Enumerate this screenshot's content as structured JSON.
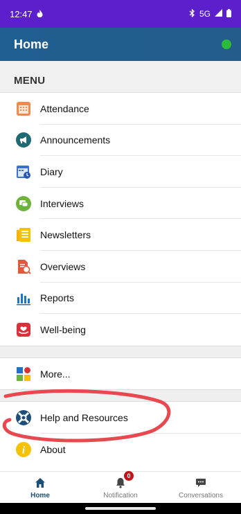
{
  "status_bar": {
    "time": "12:47",
    "network": "5G"
  },
  "app_bar": {
    "title": "Home"
  },
  "menu": {
    "header": "MENU",
    "items": [
      {
        "label": "Attendance",
        "icon": "attendance-icon"
      },
      {
        "label": "Announcements",
        "icon": "announcements-icon"
      },
      {
        "label": "Diary",
        "icon": "diary-icon"
      },
      {
        "label": "Interviews",
        "icon": "interviews-icon"
      },
      {
        "label": "Newsletters",
        "icon": "newsletters-icon"
      },
      {
        "label": "Overviews",
        "icon": "overviews-icon"
      },
      {
        "label": "Reports",
        "icon": "reports-icon"
      },
      {
        "label": "Well-being",
        "icon": "wellbeing-icon"
      }
    ],
    "more": {
      "label": "More..."
    },
    "help": {
      "label": "Help and Resources"
    },
    "about": {
      "label": "About"
    }
  },
  "bottom_nav": {
    "home": "Home",
    "notification": "Notification",
    "notification_count": "0",
    "conversations": "Conversations"
  },
  "colors": {
    "status_bar": "#5b1fcc",
    "app_bar": "#1f5f92",
    "online": "#2dbb3b",
    "annotation": "#e8484f"
  }
}
